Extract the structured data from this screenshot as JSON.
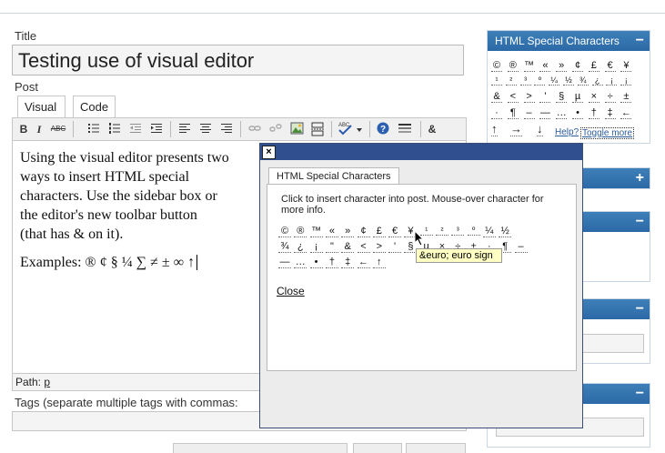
{
  "post": {
    "title_label": "Title",
    "title_value": "Testing use of visual editor",
    "post_label": "Post",
    "tabs": [
      "Visual",
      "Code"
    ],
    "content_lines": [
      "Using the visual editor presents two",
      "ways to insert HTML special",
      "characters.  Use the sidebar box or",
      "the editor's new toolbar button",
      "(that has & on it)."
    ],
    "examples_line": "Examples: ®  ¢ § ¼ ∑ ≠ ± ∞ ↑",
    "path_label": "Path:",
    "path_value": "p",
    "tags_label": "Tags (separate multiple tags with commas:"
  },
  "toolbar": {
    "bold": "B",
    "italic": "I",
    "strike": "ABC",
    "special_chars": "&",
    "spellcheck": "ABC"
  },
  "sidebar": {
    "special_title": "HTML Special Characters",
    "collapse_symbol": "−",
    "expand_symbol": "+",
    "rows": [
      [
        "©",
        "®",
        "™",
        "«",
        "»",
        "¢",
        "£",
        "€",
        "¥"
      ],
      [
        "¹",
        "²",
        "³",
        "º",
        "¼",
        "½",
        "¾",
        "¿",
        "¡",
        "¡"
      ],
      [
        "&",
        "<",
        ">",
        "'",
        "§",
        "µ",
        "×",
        "÷",
        "±"
      ],
      [
        "·",
        "¶",
        "–",
        "—",
        "…",
        "•",
        "†",
        "‡",
        "←"
      ]
    ],
    "arrows": [
      "↑",
      "→",
      "↓"
    ],
    "help_label": "Help?",
    "toggle_label": "Toggle more",
    "box_symbols": [
      "+",
      "−",
      "−",
      "−"
    ]
  },
  "popup": {
    "close_x": "×",
    "tab_label": "HTML Special Characters",
    "instructions": "Click to insert character into post. Mouse-over character for more info.",
    "row1": [
      "©",
      "®",
      "™",
      "«",
      "»",
      "¢",
      "£",
      "€",
      "¥",
      "¹",
      "²",
      "³",
      "º",
      "¼",
      "½"
    ],
    "row2": [
      "¾",
      "¿",
      "¡",
      "\"",
      "&",
      "<",
      ">",
      "'",
      "§",
      "µ",
      "×",
      "÷",
      "±",
      "·",
      "¶",
      "–"
    ],
    "row3": [
      "—",
      "…",
      "•",
      "†",
      "‡",
      "←",
      "↑"
    ],
    "close_label": "Close",
    "tooltip": "&euro; euro sign"
  }
}
